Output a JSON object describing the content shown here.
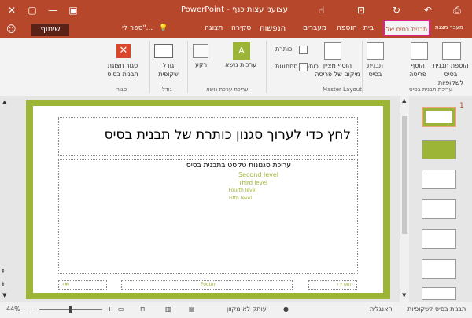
{
  "window": {
    "title": "PowerPoint - עצועני עצות כנף",
    "account_name": "ספר לי\"...",
    "share_label": "שיתוף",
    "back_label": "בית"
  },
  "tabs": {
    "active": "תבנית בסיס של שקופית",
    "items": [
      {
        "label": "בית"
      },
      {
        "label": "הוספה"
      },
      {
        "label": "מעברים"
      },
      {
        "label": "הנפשות"
      },
      {
        "label": "סקירה"
      },
      {
        "label": "תצוגה"
      }
    ]
  },
  "ribbon": {
    "insert_master_label": "הוספת תבנית בסיס לשקופיות",
    "insert_layout_label": "הוסף פריסה",
    "master_layout_label": "תבנית בסיס",
    "insert_placeholder_label": "הוסף מציין מיקום של פריסה",
    "title_label": "כותרת",
    "footers_label": "כותרות תחתונות",
    "themes_label": "ערכות נושא",
    "background_label": "רקע",
    "slide_size_label": "גודל שקופית",
    "close_master_label": "סגור תצוגת תבנית בסיס",
    "group_edit_master": "עריכת תבנית בסיס",
    "group_master_layout": "Master Layout",
    "group_edit_theme": "עריכת ערכת נושא",
    "group_size": "גודל",
    "group_close": "סגור"
  },
  "slide": {
    "title_text": "לחץ כדי לערוך סגנון כותרת של תבנית בסיס",
    "body_levels": [
      {
        "text": "עריכת סגנונות טקסט בתבנית בסיס"
      },
      {
        "text": "Second level"
      },
      {
        "text": "Third level"
      },
      {
        "text": "Fourth level"
      },
      {
        "text": "Fifth level"
      }
    ],
    "footer_left": "‹#›",
    "footer_center": "Footer",
    "footer_right": "‹תאריך›"
  },
  "thumbnails": {
    "first_number": "1"
  },
  "status": {
    "view_label": "תבנית בסיס לשקופיות",
    "language_label": "האנגלית",
    "accessibility_label": "עותק לא מקוון",
    "zoom_label": "44%"
  },
  "colors": {
    "accent": "#b7472a",
    "slide_border": "#9cb536",
    "highlight": "#e0218a"
  }
}
